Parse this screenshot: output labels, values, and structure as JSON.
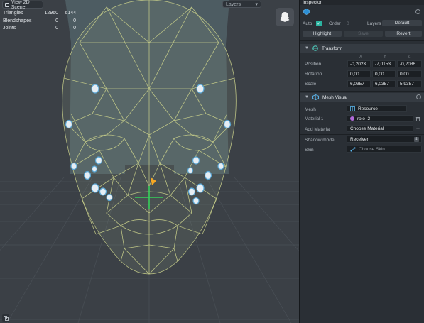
{
  "viewport": {
    "view2d_label": "View 2D Scene",
    "layers_label": "Layers",
    "stats": [
      {
        "label": "Triangles",
        "v1": "12960",
        "v2": "6144"
      },
      {
        "label": "Blendshapes",
        "v1": "0",
        "v2": "0"
      },
      {
        "label": "Joints",
        "v1": "0",
        "v2": "0"
      }
    ]
  },
  "inspector": {
    "title": "Inspector",
    "auto_label": "Auto",
    "order_label": "Order",
    "order_value": "0",
    "layers_label": "Layers",
    "layers_value": "Default",
    "highlight_label": "Highlight",
    "disabled_btn_label": "Save",
    "revert_label": "Revert",
    "transform": {
      "title": "Transform",
      "axes": [
        "X",
        "Y",
        "Z"
      ],
      "position_label": "Position",
      "position": [
        "-0,2023",
        "-7,0153",
        "-0,2086"
      ],
      "rotation_label": "Rotation",
      "rotation": [
        "0,00",
        "0,00",
        "0,00"
      ],
      "scale_label": "Scale",
      "scale": [
        "6,0357",
        "6,0357",
        "5,9357"
      ]
    },
    "mesh_visual": {
      "title": "Mesh Visual",
      "mesh_label": "Mesh",
      "mesh_value": "Resource",
      "material_label": "Material 1",
      "material_value": "rojo_2",
      "add_material_label": "Add Material",
      "add_material_value": "Choose Material",
      "shadow_label": "Shadow mode",
      "shadow_value": "Receiver",
      "skin_label": "Skin",
      "skin_value": "Choose Skin"
    }
  },
  "colors": {
    "viewport_bg": "#3b4046",
    "mesh_wire": "#c8cf8a",
    "panel_bg": "#2a2f35",
    "checkbox": "#2bb3a0",
    "gizmo": "#36d05a",
    "accent": "#f5a623"
  }
}
